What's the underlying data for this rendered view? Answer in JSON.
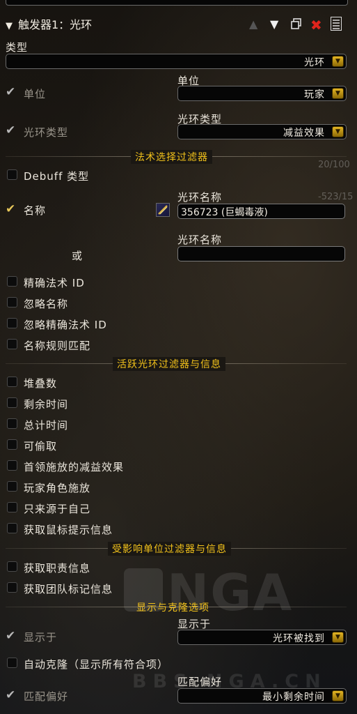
{
  "header": {
    "title": "触发器1：光环"
  },
  "type_section": {
    "label": "类型",
    "value": "光环"
  },
  "unit": {
    "check_label": "单位",
    "dropdown_label": "单位",
    "value": "玩家"
  },
  "aura_type": {
    "check_label": "光环类型",
    "dropdown_label": "光环类型",
    "value": "减益效果"
  },
  "spell_filter": {
    "heading": "法术选择过滤器",
    "debuff_type_label": "Debuff 类型",
    "name_label": "名称",
    "aura_name_label_1": "光环名称",
    "aura_name_value_1": "356723 (巨蝎毒液)",
    "or_label": "或",
    "aura_name_label_2": "光环名称",
    "aura_name_value_2": "",
    "options": [
      "精确法术 ID",
      "忽略名称",
      "忽略精确法术 ID",
      "名称规则匹配"
    ]
  },
  "active_filter": {
    "heading": "活跃光环过滤器与信息",
    "options": [
      "堆叠数",
      "剩余时间",
      "总计时间",
      "可偷取",
      "首领施放的减益效果",
      "玩家角色施放",
      "只来源于自己",
      "获取鼠标提示信息"
    ]
  },
  "affected_filter": {
    "heading": "受影响单位过滤器与信息",
    "options": [
      "获取职责信息",
      "获取团队标记信息"
    ]
  },
  "show_clone": {
    "heading": "显示与克隆选项",
    "show_on_check": "显示于",
    "show_on_label": "显示于",
    "show_on_value": "光环被找到",
    "auto_clone": "自动克隆（显示所有符合项）",
    "match_pref_check": "匹配偏好",
    "match_pref_label": "匹配偏好",
    "match_pref_value": "最小剩余时间"
  },
  "background_text": {
    "r1": "20/100",
    "r2": "-523/15",
    "watermark_logo": "NGA",
    "watermark_url": "BBS.NGA.CN"
  },
  "icons": [
    "chevron-down-icon",
    "move-up-icon",
    "move-down-icon",
    "duplicate-icon",
    "delete-icon",
    "menu-icon",
    "spell-icon"
  ],
  "colors": {
    "accent_gold": "#f2c21b",
    "delete_red": "#e0241c"
  }
}
